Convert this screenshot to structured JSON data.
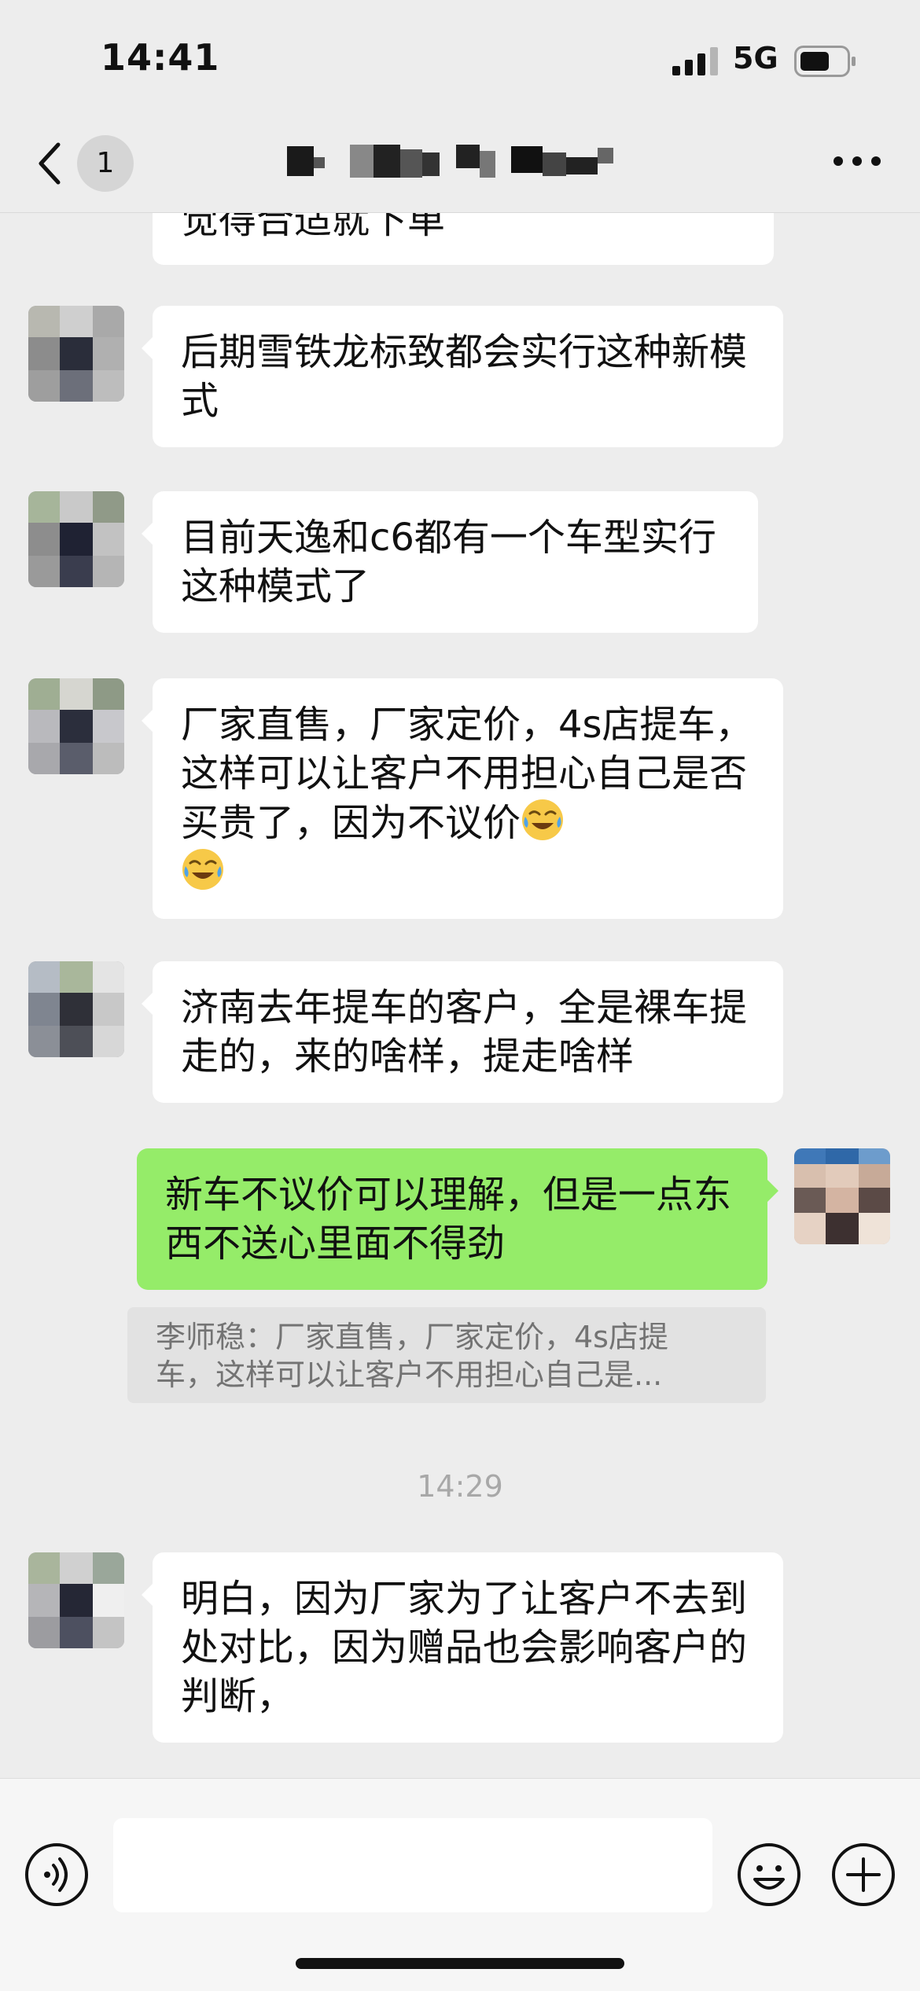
{
  "status_bar": {
    "time": "14:41",
    "network": "5G"
  },
  "nav": {
    "unread_count": "1"
  },
  "messages": [
    {
      "id": "m0",
      "direction": "in",
      "text": "觉得合适就下单"
    },
    {
      "id": "m1",
      "direction": "in",
      "text": "后期雪铁龙标致都会实行这种新模式"
    },
    {
      "id": "m2",
      "direction": "in",
      "text": "目前天逸和c6都有一个车型实行这种模式了"
    },
    {
      "id": "m3",
      "direction": "in",
      "text": "厂家直售，厂家定价，4s店提车，这样可以让客户不用担心自己是否买贵了，因为不议价",
      "emojis": [
        "face-with-tears-of-joy-icon",
        "face-with-tears-of-joy-icon"
      ]
    },
    {
      "id": "m4",
      "direction": "in",
      "text": "济南去年提车的客户，全是裸车提走的，来的啥样，提走啥样"
    },
    {
      "id": "m5",
      "direction": "out",
      "text": "新车不议价可以理解，但是一点东西不送心里面不得劲",
      "quote": {
        "line1": "李师稳：厂家直售，厂家定价，4s店提",
        "line2": "车，这样可以让客户不用担心自己是..."
      }
    },
    {
      "id": "ts1",
      "type": "timestamp",
      "text": "14:29"
    },
    {
      "id": "m6",
      "direction": "in",
      "text": "明白，因为厂家为了让客户不去到处对比，因为赠品也会影响客户的判断，"
    }
  ],
  "input_bar": {
    "placeholder": "",
    "value": ""
  },
  "colors": {
    "background": "#ededed",
    "incoming_bubble": "#ffffff",
    "outgoing_bubble": "#95ec69",
    "quote_background": "#e2e2e2",
    "timestamp_text": "#a8a8a8"
  },
  "icons": {
    "back": "chevron-left-icon",
    "more": "more-dots-icon",
    "voice": "voice-icon",
    "emoji": "smiley-icon",
    "plus": "plus-icon",
    "signal": "signal-icon",
    "battery": "battery-icon"
  }
}
